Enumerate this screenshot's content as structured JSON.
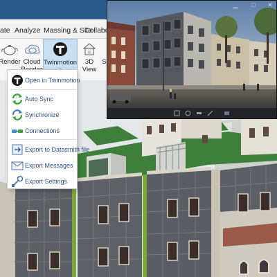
{
  "ribbon": {
    "tabs": [
      "ate",
      "Analyze",
      "Massing & Site",
      "Collaborate"
    ],
    "tools": {
      "render": "Render",
      "cloud": "Cloud\nRendering",
      "twinmotion": "Twinmotion",
      "view3d": "3D\nView",
      "se": "Se"
    }
  },
  "menu": {
    "items": [
      {
        "label": "Open in Twinmotion",
        "icon": "twinmotion-logo-icon"
      },
      {
        "label": "Auto Sync",
        "icon": "auto-sync-icon"
      },
      {
        "label": "Synchronize",
        "icon": "synchronize-icon"
      },
      {
        "label": "Connections",
        "icon": "connections-icon"
      },
      {
        "label": "Export to Datasmith file",
        "icon": "datasmith-export-icon"
      },
      {
        "label": "Export Messages",
        "icon": "export-messages-icon"
      },
      {
        "label": "Export Settings",
        "icon": "export-settings-icon"
      }
    ]
  },
  "colors": {
    "ribbon_blue": "#2b5b8a",
    "menu_text": "#2d4f8e",
    "selected_tool": "#c9dff2",
    "roof_green": "#3a7d3a",
    "glass_dark": "#4a4d52"
  }
}
